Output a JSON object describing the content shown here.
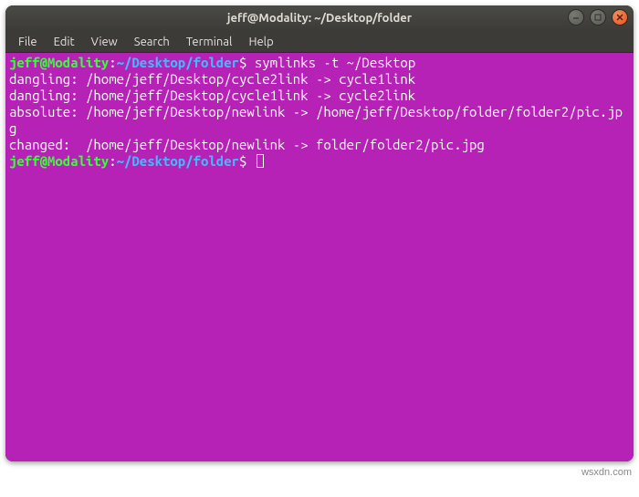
{
  "window": {
    "title": "jeff@Modality: ~/Desktop/folder"
  },
  "menubar": {
    "items": [
      "File",
      "Edit",
      "View",
      "Search",
      "Terminal",
      "Help"
    ]
  },
  "prompt": {
    "user_host": "jeff@Modality",
    "colon": ":",
    "path": "~/Desktop/folder",
    "symbol": "$"
  },
  "session": {
    "command": "symlinks -t ~/Desktop",
    "output_lines": [
      "dangling: /home/jeff/Desktop/cycle2link -> cycle1link",
      "dangling: /home/jeff/Desktop/cycle1link -> cycle2link",
      "absolute: /home/jeff/Desktop/newlink -> /home/jeff/Desktop/folder/folder2/pic.jpg",
      "changed:  /home/jeff/Desktop/newlink -> folder/folder2/pic.jpg"
    ]
  },
  "watermark": "wsxdn.com"
}
